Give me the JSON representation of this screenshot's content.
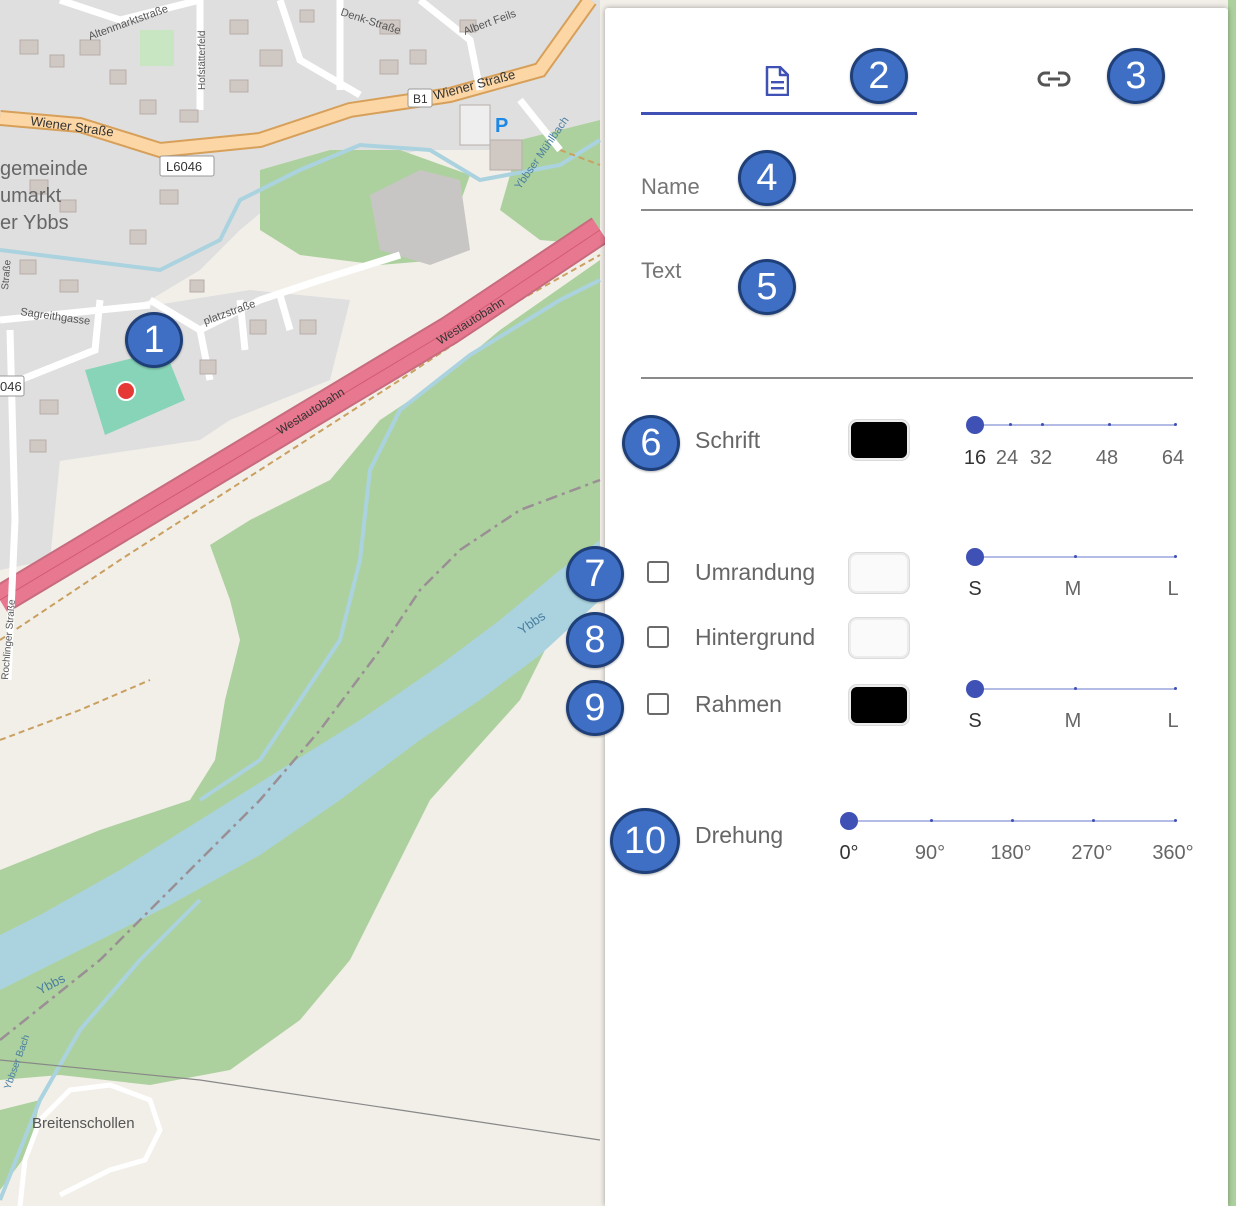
{
  "map": {
    "labels": {
      "altenmarkt": "Altenmarktstraße",
      "denk": "Denk-Straße",
      "albert": "Albert Feils",
      "hofstaetter": "Hofstätterfeld",
      "wiener1": "Wiener Straße",
      "wiener2": "Wiener Straße",
      "b1": "B1",
      "l6046": "L6046",
      "l6046b": "046",
      "gemeinde1": "gemeinde",
      "gemeinde2": "umarkt",
      "gemeinde3": "er Ybbs",
      "sagreith": "Sagreithgasse",
      "platz": "platzstraße",
      "west1": "Westautobahn",
      "west2": "Westautobahn",
      "west3": "Westautobahn",
      "ybbs1": "Ybbs",
      "ybbs2": "Ybbs",
      "ybbser": "Ybbser Mühlbach",
      "rochlinger": "Rochlinger Straße",
      "breitenschollen": "Breitenschollen",
      "parking": "P",
      "strasse_left": "Straße",
      "gerbach": "Ybbser Bach"
    }
  },
  "panel": {
    "tabs": [
      {
        "icon": "document-icon",
        "label": "Dokument",
        "active": true
      },
      {
        "icon": "link-icon",
        "label": "Link",
        "active": false
      }
    ],
    "name_label": "Name",
    "text_label": "Text",
    "font_row": {
      "label": "Schrift",
      "color": "#000000",
      "slider": {
        "ticks": [
          "16",
          "24",
          "32",
          "48",
          "64"
        ],
        "value": "16"
      }
    },
    "outline_row": {
      "label": "Umrandung",
      "checked": false,
      "color": "#fafafa",
      "slider": {
        "ticks": [
          "S",
          "M",
          "L"
        ],
        "value": "S"
      }
    },
    "background_row": {
      "label": "Hintergrund",
      "checked": false,
      "color": "#fafafa"
    },
    "frame_row": {
      "label": "Rahmen",
      "checked": false,
      "color": "#000000",
      "slider": {
        "ticks": [
          "S",
          "M",
          "L"
        ],
        "value": "S"
      }
    },
    "rotation_row": {
      "label": "Drehung",
      "slider": {
        "ticks": [
          "0°",
          "90°",
          "180°",
          "270°",
          "360°"
        ],
        "value": "0°"
      }
    }
  },
  "badges": [
    "1",
    "2",
    "3",
    "4",
    "5",
    "6",
    "7",
    "8",
    "9",
    "10"
  ],
  "colors": {
    "accent": "#3f51b5",
    "badge": "#3f6fc4",
    "motorway": "#e8788f",
    "forest": "#add19e",
    "river": "#aad3df"
  }
}
